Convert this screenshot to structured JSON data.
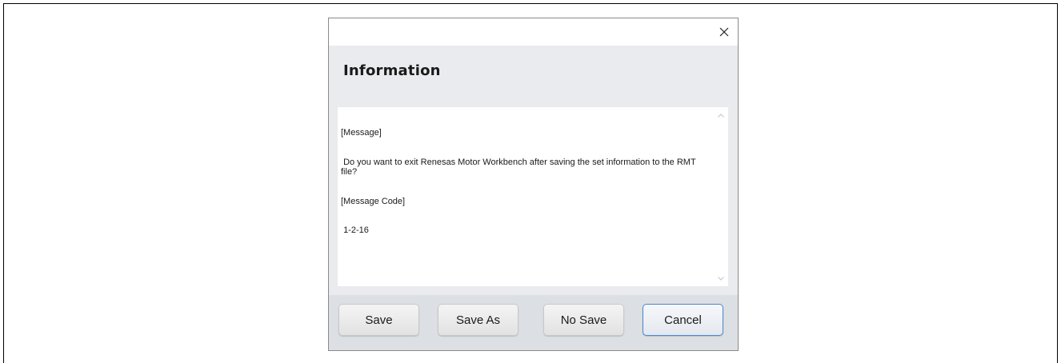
{
  "dialog": {
    "heading": "Information",
    "close_icon": "close-icon",
    "message_lines": [
      "[Message]",
      " Do you want to exit Renesas Motor Workbench after saving the set information to the RMT file?",
      "[Message Code]",
      " 1-2-16"
    ],
    "scroll_up_icon": "chevron-up-icon",
    "scroll_down_icon": "chevron-down-icon"
  },
  "buttons": {
    "save_label": "Save",
    "save_as_label": "Save As",
    "no_save_label": "No Save",
    "cancel_label": "Cancel"
  },
  "colors": {
    "header_bg": "#e9ebee",
    "footer_bg": "#dcdfe3",
    "focus_border": "#4a88d0"
  }
}
